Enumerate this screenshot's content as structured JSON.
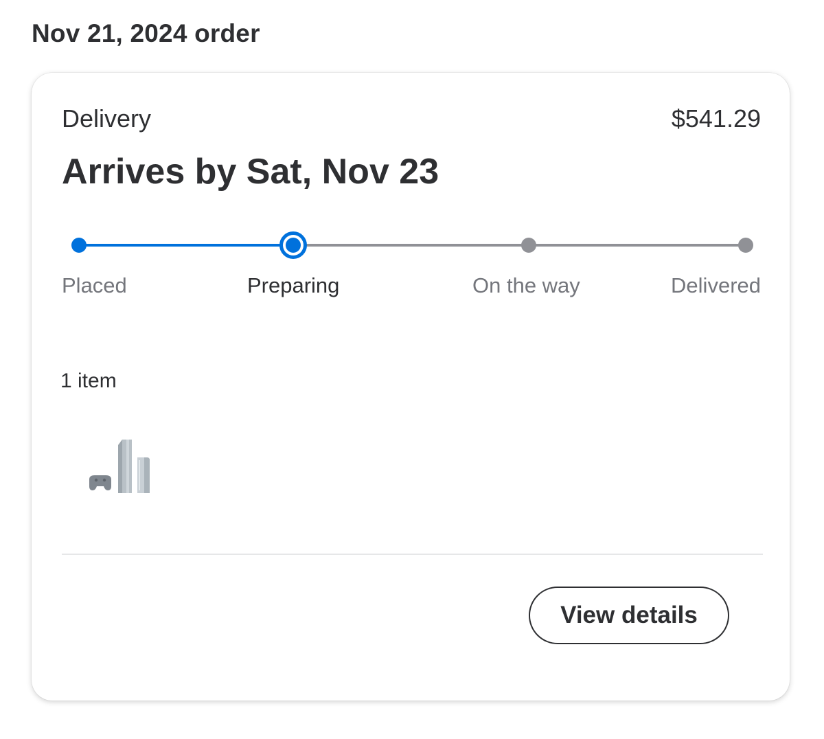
{
  "order": {
    "heading": "Nov 21, 2024 order",
    "fulfillment_type": "Delivery",
    "total": "$541.29",
    "arrival": "Arrives by Sat, Nov 23",
    "progress": {
      "steps": [
        "Placed",
        "Preparing",
        "On the way",
        "Delivered"
      ],
      "current_step_index": 1
    },
    "item_count": "1 item",
    "items": [
      {
        "image_icon": "game-console-bundle-icon"
      }
    ],
    "view_details_label": "View details"
  },
  "colors": {
    "accent": "#0071dc",
    "inactive": "#909196",
    "text": "#2e2f32",
    "muted_text": "#74767c"
  }
}
